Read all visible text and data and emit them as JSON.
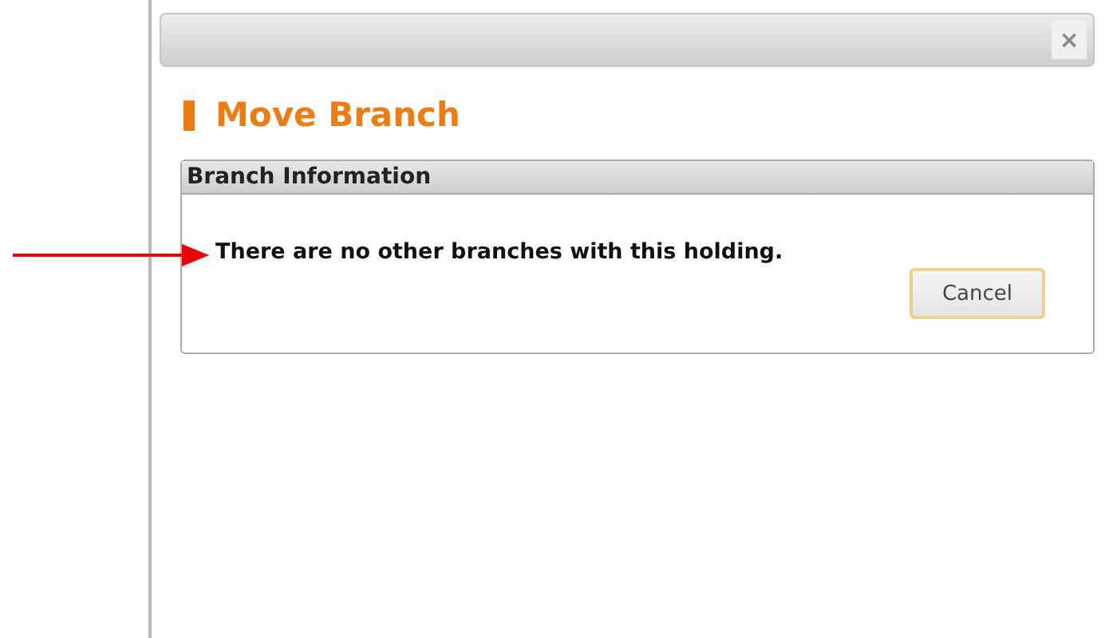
{
  "dialog": {
    "close_label": "×",
    "title": "Move Branch"
  },
  "panel": {
    "title": "Branch Information",
    "message": "There are no other branches with this holding.",
    "buttons": [
      "Cancel"
    ]
  }
}
